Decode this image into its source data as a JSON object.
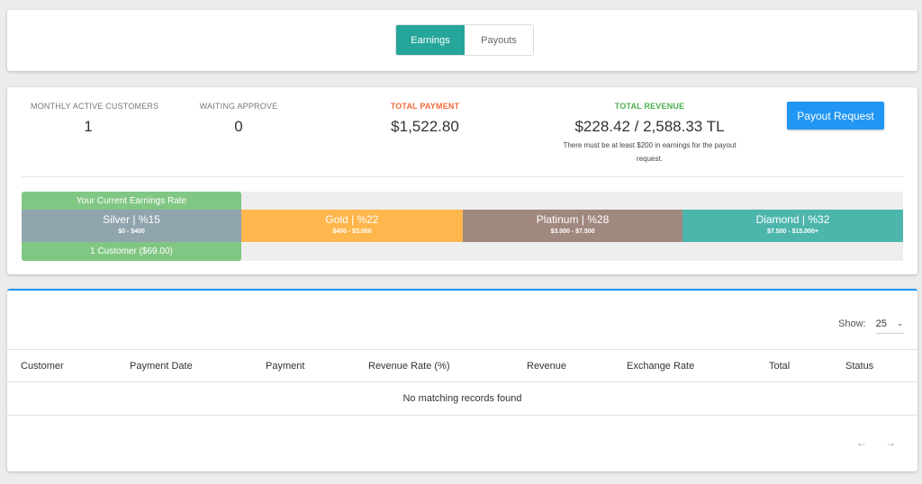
{
  "tabs": [
    {
      "label": "Earnings",
      "active": true
    },
    {
      "label": "Payouts",
      "active": false
    }
  ],
  "stats": {
    "monthly_active_customers": {
      "label": "MONTHLY ACTIVE CUSTOMERS",
      "value": "1"
    },
    "waiting_approve": {
      "label": "WAITING APPROVE",
      "value": "0"
    },
    "total_payment": {
      "label": "TOTAL PAYMENT",
      "value": "$1,522.80"
    },
    "total_revenue": {
      "label": "TOTAL REVENUE",
      "value": "$228.42 / 2,588.33 TL",
      "note": "There must be at least $200 in earnings for the payout request."
    },
    "payout_button": "Payout Request"
  },
  "rates": {
    "current_label": "Your Current Earnings Rate",
    "current_detail": "1 Customer ($69.00)",
    "tiers": [
      {
        "name": "Silver | %15",
        "range": "$0 - $400",
        "color": "#90a4ae"
      },
      {
        "name": "Gold | %22",
        "range": "$400 - $3.000",
        "color": "#ffb74d"
      },
      {
        "name": "Platinum | %28",
        "range": "$3.000 - $7.500",
        "color": "#a1887f"
      },
      {
        "name": "Diamond | %32",
        "range": "$7.500 - $15.000+",
        "color": "#4db6ac"
      }
    ]
  },
  "table": {
    "show_label": "Show:",
    "show_value": "25",
    "columns": [
      "Customer",
      "Payment Date",
      "Payment",
      "Revenue Rate (%)",
      "Revenue",
      "Exchange Rate",
      "Total",
      "Status"
    ],
    "empty_message": "No matching records found",
    "prev": "←",
    "next": "→"
  },
  "colors": {
    "accent": "#26a69a",
    "primary": "#2196f3",
    "orange": "#f26b3a",
    "green": "#4caf50"
  }
}
